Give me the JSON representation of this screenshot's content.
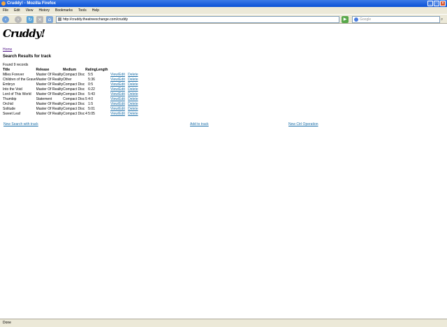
{
  "window": {
    "title": "Cruddy! - Mozilla Firefox"
  },
  "menu": [
    "File",
    "Edit",
    "View",
    "History",
    "Bookmarks",
    "Tools",
    "Help"
  ],
  "url": "http://cruddy.theatreexchange.com/cruddy",
  "search_placeholder": "Google",
  "logo": "Cruddy!",
  "home_link": "Home",
  "heading": "Search Results for track",
  "found": "Found 9 records",
  "table": {
    "headers": [
      "Title",
      "Release",
      "Medium",
      "Rating",
      "Length",
      "",
      ""
    ],
    "rows": [
      [
        "Miles Forever",
        "Master Of Reality",
        "Compact Disc",
        "",
        "5:5",
        "View/Edit",
        "Delete"
      ],
      [
        "Children of the Grave",
        "Master Of Reality",
        "Other",
        "",
        "5:36",
        "View/Edit",
        "Delete"
      ],
      [
        "Embryo",
        "Master Of Reality",
        "Compact Disc",
        "",
        "0:5",
        "View/Edit",
        "Delete"
      ],
      [
        "Into the Void",
        "Master Of Reality",
        "Compact Disc",
        "",
        "6:22",
        "View/Edit",
        "Delete"
      ],
      [
        "Lord of This World",
        "Master Of Reality",
        "Compact Disc",
        "",
        "5:43",
        "View/Edit",
        "Delete"
      ],
      [
        "Thumbip",
        "Statement",
        "Compact Disc",
        "5",
        "4:0",
        "View/Edit",
        "Delete"
      ],
      [
        "Orchid",
        "Master Of Reality",
        "Compact Disc",
        "",
        "1:5",
        "View/Edit",
        "Delete"
      ],
      [
        "Solitude",
        "Master Of Reality",
        "Compact Disc",
        "",
        "5:01",
        "View/Edit",
        "Delete"
      ],
      [
        "Sweet Leaf",
        "Master Of Reality",
        "Compact Disc",
        "4",
        "5:05",
        "View/Edit",
        "Delete"
      ]
    ]
  },
  "footer": {
    "new_search": "New Search with track",
    "add": "Add to track",
    "new_op": "New Ctrl Operation"
  },
  "status": "Done"
}
